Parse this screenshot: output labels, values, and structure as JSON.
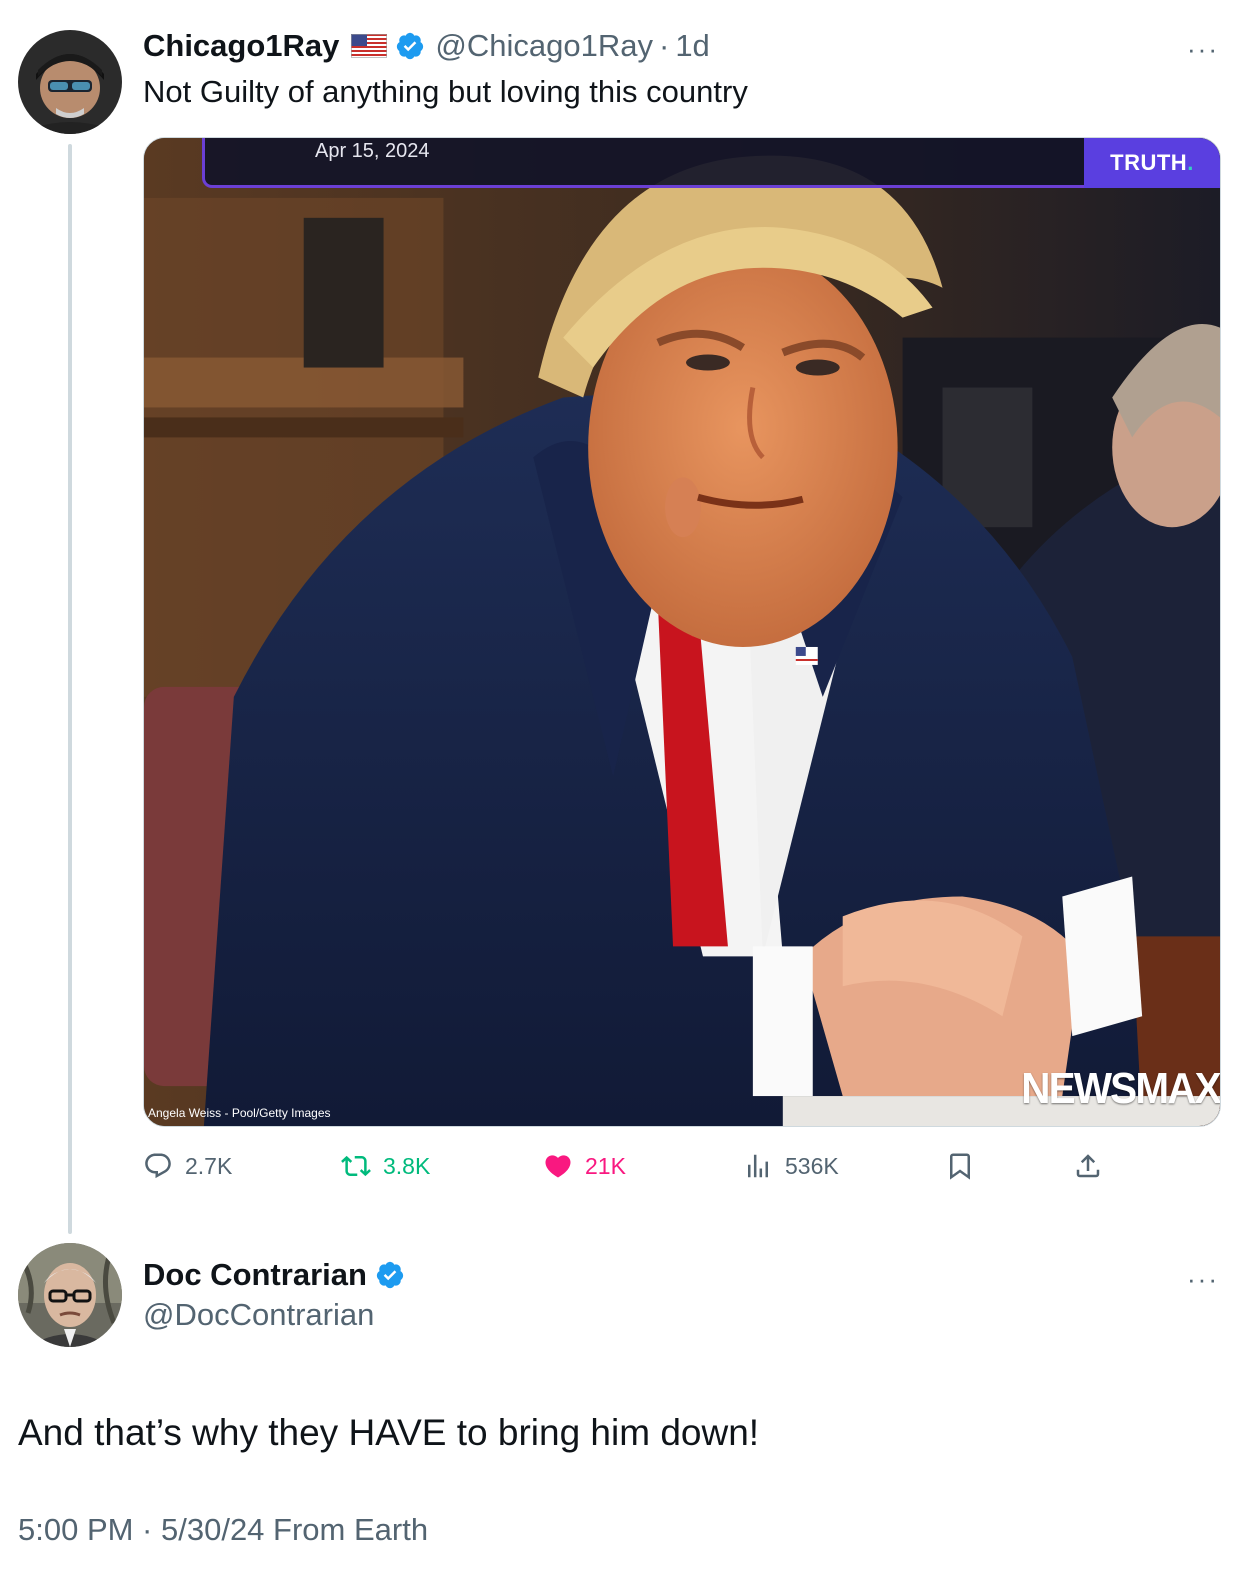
{
  "tweet": {
    "author_name": "Chicago1Ray",
    "flag_icon": "us-flag-icon",
    "verified": true,
    "handle": "@Chicago1Ray",
    "separator": "·",
    "relative_time": "1d",
    "more_label": "···",
    "text": "Not Guilty of anything but loving this country",
    "media": {
      "date_overlay": "Apr 15, 2024",
      "brand_badge": "TRUTH",
      "brand_badge_dot": ".",
      "photo_credit": "Angela Weiss - Pool/Getty Images",
      "watermark": "NEWSMAX"
    },
    "actions": {
      "replies": "2.7K",
      "reposts": "3.8K",
      "likes": "21K",
      "views": "536K"
    }
  },
  "reply": {
    "author_name": "Doc Contrarian",
    "verified": true,
    "handle": "@DocContrarian",
    "more_label": "···",
    "text": "And that’s why they HAVE to bring him down!",
    "timestamp": "5:00 PM · 5/30/24 From Earth"
  },
  "colors": {
    "verified_blue": "#1d9bf0",
    "repost_green": "#00ba7c",
    "like_pink": "#f91880",
    "muted_text": "#536471",
    "truth_purple": "#5a3fe0"
  }
}
